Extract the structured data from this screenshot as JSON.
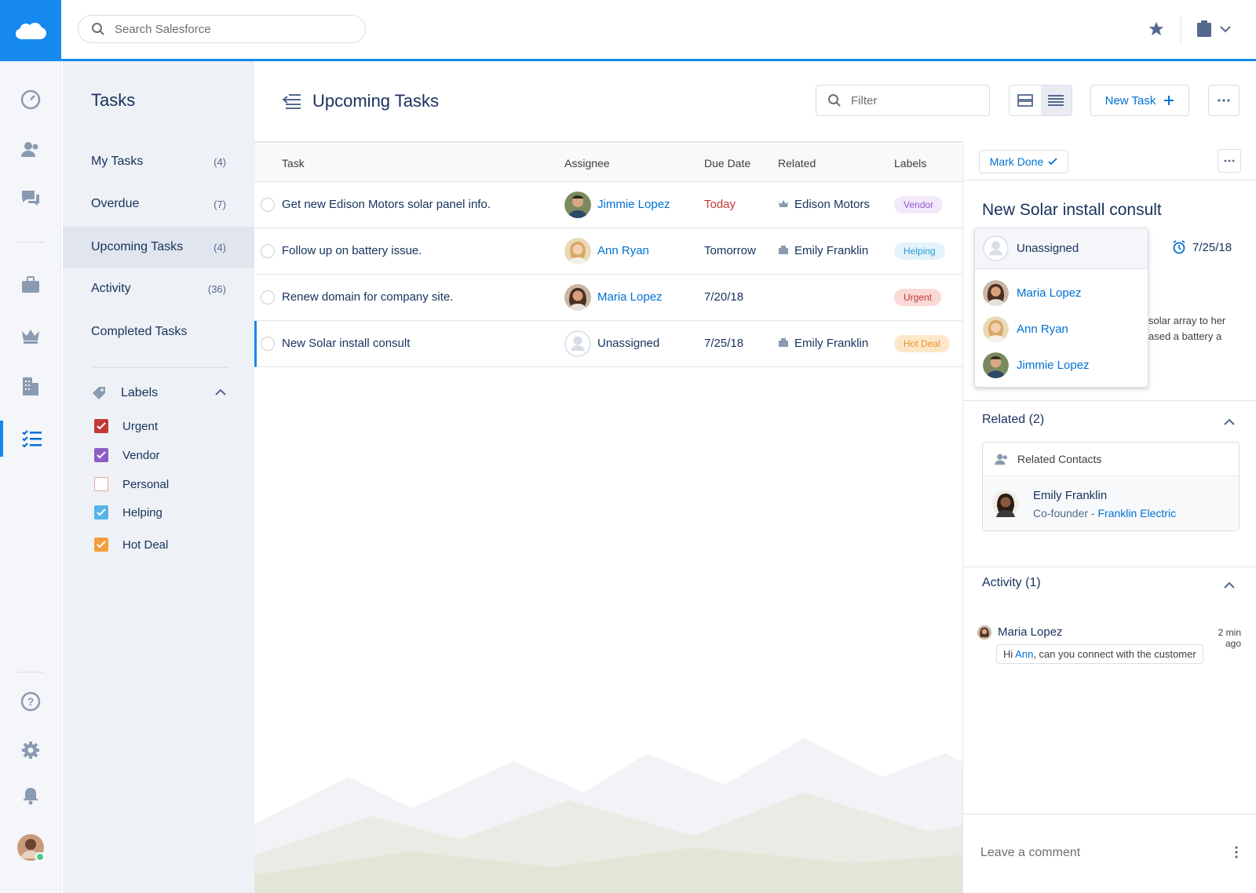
{
  "search": {
    "placeholder": "Search Salesforce"
  },
  "sidebar": {
    "title": "Tasks",
    "items": [
      {
        "label": "My Tasks",
        "count": "(4)"
      },
      {
        "label": "Overdue",
        "count": "(7)"
      },
      {
        "label": "Upcoming Tasks",
        "count": "(4)"
      },
      {
        "label": "Activity",
        "count": "(36)"
      },
      {
        "label": "Completed Tasks",
        "count": ""
      }
    ],
    "labels_heading": "Labels",
    "labels": [
      {
        "name": "Urgent",
        "color": "#c23934",
        "checked": true
      },
      {
        "name": "Vendor",
        "color": "#8e5cc5",
        "checked": true
      },
      {
        "name": "Personal",
        "color": "#e8a4a4",
        "checked": false
      },
      {
        "name": "Helping",
        "color": "#56b4e9",
        "checked": true
      },
      {
        "name": "Hot Deal",
        "color": "#f59e3d",
        "checked": true
      }
    ]
  },
  "main": {
    "title": "Upcoming Tasks",
    "filter_placeholder": "Filter",
    "new_task_label": "New Task",
    "columns": [
      "Task",
      "Assignee",
      "Due Date",
      "Related",
      "Labels"
    ],
    "rows": [
      {
        "task": "Get new Edison Motors solar panel info.",
        "assignee": "Jimmie Lopez",
        "due": "Today",
        "related": "Edison Motors",
        "label": "Vendor"
      },
      {
        "task": "Follow up on battery issue.",
        "assignee": "Ann Ryan",
        "due": "Tomorrow",
        "related": "Emily Franklin",
        "label": "Helping"
      },
      {
        "task": "Renew domain for company site.",
        "assignee": "Maria Lopez",
        "due": "7/20/18",
        "related": "",
        "label": "Urgent"
      },
      {
        "task": "New Solar install consult",
        "assignee": "Unassigned",
        "due": "7/25/18",
        "related": "Emily Franklin",
        "label": "Hot Deal"
      }
    ]
  },
  "detail": {
    "mark_done_label": "Mark Done",
    "title": "New Solar install consult",
    "due": "7/25/18",
    "desc_line1": "solar array to her",
    "desc_line2": "ased a battery a",
    "assign_dropdown": {
      "selected": "Unassigned",
      "options": [
        "Maria Lopez",
        "Ann Ryan",
        "Jimmie Lopez"
      ]
    },
    "related_heading": "Related (2)",
    "related_contacts_label": "Related Contacts",
    "contact_name": "Emily Franklin",
    "contact_role": "Co-founder - ",
    "contact_company": "Franklin Electric",
    "activity_heading": "Activity (1)",
    "activity_author": "Maria Lopez",
    "activity_time": "2 min ago",
    "activity_msg_pre": "Hi ",
    "activity_mention": "Ann",
    "activity_msg_post": ", can you connect with the customer",
    "comment_placeholder": "Leave a comment"
  },
  "colors": {
    "brand": "#1589ee",
    "link": "#0070d2",
    "overdue": "#c23934",
    "pill_vendor_bg": "#f2e9fb",
    "pill_vendor_fg": "#8e5cc5",
    "pill_helping_bg": "#e3f3fc",
    "pill_helping_fg": "#2a9bd6",
    "pill_urgent_bg": "#f9d8d6",
    "pill_urgent_fg": "#c23934",
    "pill_hotdeal_bg": "#fde7c9",
    "pill_hotdeal_fg": "#e8962c"
  },
  "icons": [
    "salesforce-cloud-icon",
    "search-icon",
    "star-icon",
    "clipboard-icon",
    "dashboard-icon",
    "contacts-icon",
    "chat-icon",
    "briefcase-icon",
    "crown-icon",
    "building-icon",
    "tasks-icon",
    "help-icon",
    "gear-icon",
    "bell-icon",
    "tag-icon",
    "alarm-clock-icon"
  ]
}
